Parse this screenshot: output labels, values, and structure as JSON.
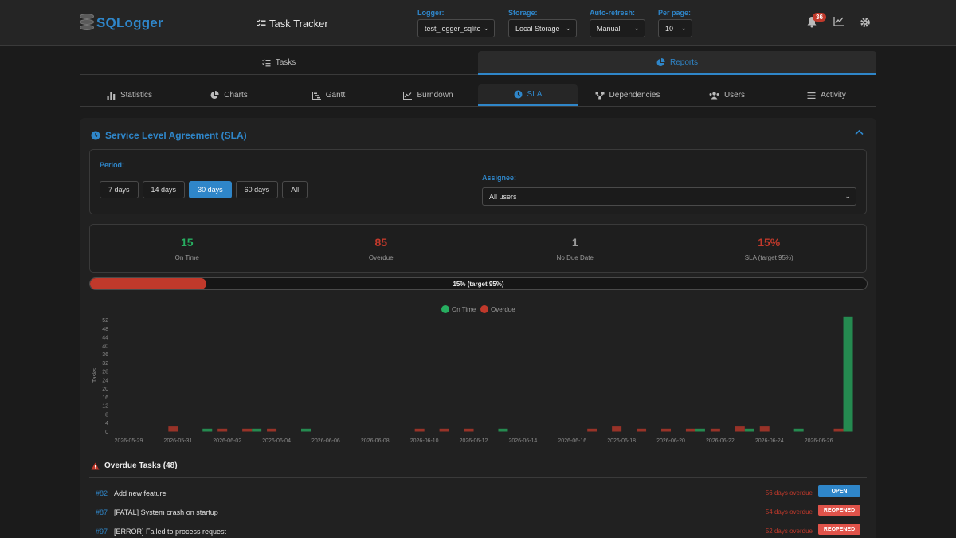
{
  "app": {
    "logo_text": "SQLogger",
    "title": "Task Tracker"
  },
  "controls": {
    "logger": {
      "label": "Logger:",
      "value": "test_logger_sqlite"
    },
    "storage": {
      "label": "Storage:",
      "value": "Local Storage"
    },
    "refresh": {
      "label": "Auto-refresh:",
      "value": "Manual"
    },
    "per_page": {
      "label": "Per page:",
      "value": "10"
    }
  },
  "notifications": {
    "count": "36"
  },
  "main_tabs": [
    {
      "label": "Tasks",
      "icon": "list-check-icon",
      "active": false
    },
    {
      "label": "Reports",
      "icon": "pie-chart-icon",
      "active": true
    }
  ],
  "sub_tabs": [
    {
      "label": "Statistics",
      "icon": "bar-chart-icon"
    },
    {
      "label": "Charts",
      "icon": "pie-chart-icon"
    },
    {
      "label": "Gantt",
      "icon": "gantt-icon"
    },
    {
      "label": "Burndown",
      "icon": "line-chart-icon"
    },
    {
      "label": "SLA",
      "icon": "clock-icon"
    },
    {
      "label": "Dependencies",
      "icon": "network-icon"
    },
    {
      "label": "Users",
      "icon": "users-icon"
    },
    {
      "label": "Activity",
      "icon": "lines-icon"
    }
  ],
  "sla": {
    "title": "Service Level Agreement (SLA)",
    "period_label": "Period:",
    "periods": [
      "7 days",
      "14 days",
      "30 days",
      "60 days",
      "All"
    ],
    "active_period": "30 days",
    "assignee_label": "Assignee:",
    "assignee_value": "All users",
    "stats": [
      {
        "value": "15",
        "label": "On Time",
        "color": "#27ae60"
      },
      {
        "value": "85",
        "label": "Overdue",
        "color": "#c0392b"
      },
      {
        "value": "1",
        "label": "No Due Date",
        "color": "#9a9a9a"
      },
      {
        "value": "15%",
        "label": "SLA (target 95%)",
        "color": "#c0392b"
      }
    ],
    "progress_percent": 15,
    "progress_text": "15% (target 95%)"
  },
  "chart_data": {
    "type": "bar",
    "ylabel": "Tasks",
    "ylim": [
      0,
      52
    ],
    "yticks": [
      0,
      4,
      8,
      12,
      16,
      20,
      24,
      28,
      32,
      36,
      40,
      44,
      48,
      52
    ],
    "x_tick_labels": [
      "2026-05-29",
      "2026-05-31",
      "2026-06-02",
      "2026-06-04",
      "2026-06-06",
      "2026-06-08",
      "2026-06-10",
      "2026-06-12",
      "2026-06-14",
      "2026-06-16",
      "2026-06-18",
      "2026-06-20",
      "2026-06-22",
      "2026-06-24",
      "2026-06-26"
    ],
    "categories": [
      "2026-05-29",
      "2026-05-30",
      "2026-05-31",
      "2026-06-01",
      "2026-06-02",
      "2026-06-03",
      "2026-06-04",
      "2026-06-05",
      "2026-06-06",
      "2026-06-07",
      "2026-06-08",
      "2026-06-09",
      "2026-06-10",
      "2026-06-11",
      "2026-06-12",
      "2026-06-13",
      "2026-06-14",
      "2026-06-15",
      "2026-06-16",
      "2026-06-17",
      "2026-06-18",
      "2026-06-19",
      "2026-06-20",
      "2026-06-21",
      "2026-06-22",
      "2026-06-23",
      "2026-06-24",
      "2026-06-25",
      "2026-06-26",
      "2026-06-27"
    ],
    "series": [
      {
        "name": "On Time",
        "color": "#27ae60",
        "values": [
          0,
          0,
          0,
          1,
          0,
          1,
          0,
          1,
          0,
          0,
          0,
          0,
          0,
          0,
          0,
          1,
          0,
          0,
          0,
          0,
          0,
          0,
          0,
          1,
          0,
          1,
          0,
          1,
          0,
          53
        ]
      },
      {
        "name": "Overdue",
        "color": "#c0392b",
        "values": [
          0,
          0,
          2,
          0,
          1,
          1,
          1,
          0,
          0,
          0,
          0,
          0,
          1,
          1,
          1,
          0,
          0,
          0,
          0,
          1,
          2,
          1,
          1,
          1,
          1,
          2,
          2,
          0,
          0,
          1
        ]
      }
    ],
    "legend_position": "top"
  },
  "overdue": {
    "title": "Overdue Tasks (48)",
    "tasks": [
      {
        "id": "#82",
        "title": "Add new feature",
        "overdue": "56 days overdue",
        "status": "OPEN",
        "status_color": "#2f86c9"
      },
      {
        "id": "#87",
        "title": "[FATAL] System crash on startup",
        "overdue": "54 days overdue",
        "status": "REOPENED",
        "status_color": "#e0534a"
      },
      {
        "id": "#97",
        "title": "[ERROR] Failed to process request",
        "overdue": "52 days overdue",
        "status": "REOPENED",
        "status_color": "#e0534a"
      }
    ]
  }
}
